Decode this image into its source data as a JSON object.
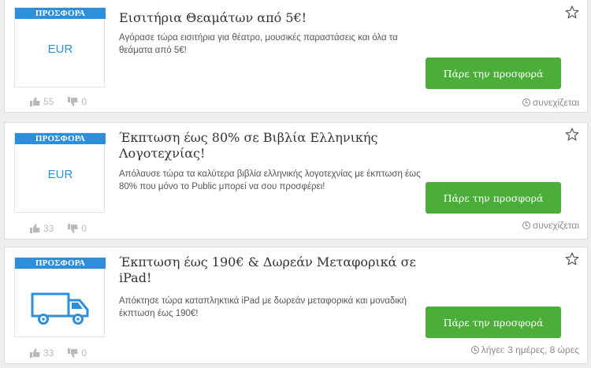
{
  "offers": [
    {
      "badge": "ΠΡΟΣΦΟΡΑ",
      "logo_text": "EUR",
      "logo_icon": "",
      "title": "Εισιτήρια Θεαμάτων από 5€!",
      "description": "Αγόρασε τώρα εισιτήρια για θέατρο, μουσικές παραστάσεις και όλα τα θεάματα από 5€!",
      "likes": "55",
      "dislikes": "0",
      "button_label": "Πάρε την προσφορά",
      "status": "συνεχίζεται"
    },
    {
      "badge": "ΠΡΟΣΦΟΡΑ",
      "logo_text": "EUR",
      "logo_icon": "",
      "title": "Έκπτωση έως 80% σε Βιβλία Ελληνικής Λογοτεχνίας!",
      "description": "Απόλαυσε τώρα τα καλύτερα βιβλία ελληνικής λογοτεχνίας με έκπτωση έως 80% που μόνο το Public μπορεί να σου προσφέρει!",
      "likes": "33",
      "dislikes": "0",
      "button_label": "Πάρε την προσφορά",
      "status": "συνεχίζεται"
    },
    {
      "badge": "ΠΡΟΣΦΟΡΑ",
      "logo_text": "",
      "logo_icon": "delivery-truck-icon",
      "title": "Έκπτωση έως 190€ & Δωρεάν Μεταφορικά σε iPad!",
      "description": "Απόκτησε τώρα καταπληκτικά iPad με δωρεάν μεταφορικά και μοναδική έκπτωση έως 190€!",
      "likes": "33",
      "dislikes": "0",
      "button_label": "Πάρε την προσφορά",
      "status": "λήγει: 3 ημέρες, 8 ώρες"
    }
  ],
  "colors": {
    "accent_blue": "#2d8fd9",
    "button_green": "#4cae3a",
    "muted_gray": "#b9b9b9"
  }
}
